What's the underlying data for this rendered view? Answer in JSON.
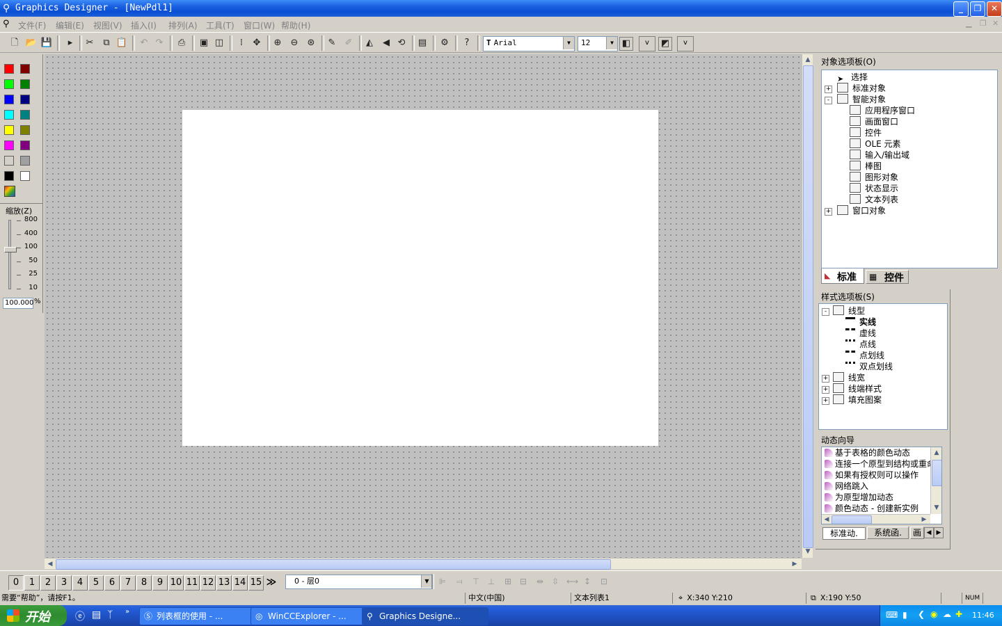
{
  "window": {
    "title": "Graphics Designer - [NewPdl1]",
    "min_icon": "minimize-icon",
    "max_icon": "restore-icon",
    "close_icon": "close-icon"
  },
  "menu": [
    "文件(F)",
    "编辑(E)",
    "视图(V)",
    "插入(I)",
    "排列(A)",
    "工具(T)",
    "窗口(W)",
    "帮助(H)"
  ],
  "toolbar": {
    "font_name": "Arial",
    "font_size": "12",
    "v1": "v",
    "v2": "v"
  },
  "palette": {
    "colors": [
      "#ff0000",
      "#800000",
      "#00ff00",
      "#008000",
      "#0000ff",
      "#000080",
      "#00ffff",
      "#008080",
      "#ffff00",
      "#808000",
      "#ff00ff",
      "#800080",
      "#d4d0c8",
      "#a0a0a0",
      "#000000",
      "#ffffff"
    ]
  },
  "zoom": {
    "title": "缩放(Z)",
    "ticks": [
      "800",
      "400",
      "100",
      "50",
      "25",
      "10"
    ],
    "value": "100.000",
    "unit": "%"
  },
  "object_palette": {
    "title": "对象选项板(O)",
    "items": [
      {
        "label": "选择",
        "level": 1
      },
      {
        "label": "标准对象",
        "level": 1,
        "expander": "+"
      },
      {
        "label": "智能对象",
        "level": 1,
        "expander": "−"
      },
      {
        "label": "应用程序窗口",
        "level": 2
      },
      {
        "label": "画面窗口",
        "level": 2
      },
      {
        "label": "控件",
        "level": 2
      },
      {
        "label": "OLE 元素",
        "level": 2
      },
      {
        "label": "输入/输出域",
        "level": 2
      },
      {
        "label": "棒图",
        "level": 2
      },
      {
        "label": "图形对象",
        "level": 2
      },
      {
        "label": "状态显示",
        "level": 2
      },
      {
        "label": "文本列表",
        "level": 2
      },
      {
        "label": "窗口对象",
        "level": 1,
        "expander": "+"
      }
    ],
    "tabs": [
      "标准",
      "控件"
    ]
  },
  "style_palette": {
    "title": "样式选项板(S)",
    "items": [
      {
        "label": "线型",
        "level": 1,
        "expander": "−"
      },
      {
        "label": "实线",
        "level": 2,
        "bold": true
      },
      {
        "label": "虚线",
        "level": 2
      },
      {
        "label": "点线",
        "level": 2
      },
      {
        "label": "点划线",
        "level": 2
      },
      {
        "label": "双点划线",
        "level": 2
      },
      {
        "label": "线宽",
        "level": 1,
        "expander": "+"
      },
      {
        "label": "线端样式",
        "level": 1,
        "expander": "+"
      },
      {
        "label": "填充图案",
        "level": 1,
        "expander": "+"
      }
    ]
  },
  "dynamic_wizard": {
    "title": "动态向导",
    "items": [
      "基于表格的颜色动态",
      "连接一个原型到结构或重命",
      "如果有授权则可以操作",
      "网络跳入",
      "为原型增加动态",
      "颜色动态 - 创建新实例"
    ],
    "tabs": [
      "标准动.",
      "系统函.",
      "画"
    ]
  },
  "layers": {
    "buttons": [
      "0",
      "1",
      "2",
      "3",
      "4",
      "5",
      "6",
      "7",
      "8",
      "9",
      "10",
      "11",
      "12",
      "13",
      "14",
      "15"
    ],
    "more": "≫",
    "selected": "0 - 层0"
  },
  "status": {
    "help": "需要“帮助”，请按F1。",
    "language": "中文(中国)",
    "object": "文本列表1",
    "position": "X:340 Y:210",
    "size": "X:190 Y:50",
    "num": "NUM"
  },
  "taskbar": {
    "start": "开始",
    "tasks": [
      {
        "label": "列表框的使用 - ...",
        "icon": "browser-icon"
      },
      {
        "label": "WinCCExplorer - ...",
        "icon": "wincc-icon"
      },
      {
        "label": "Graphics Designe...",
        "icon": "graphics-designer-icon",
        "active": true
      }
    ],
    "clock": "11:46"
  }
}
